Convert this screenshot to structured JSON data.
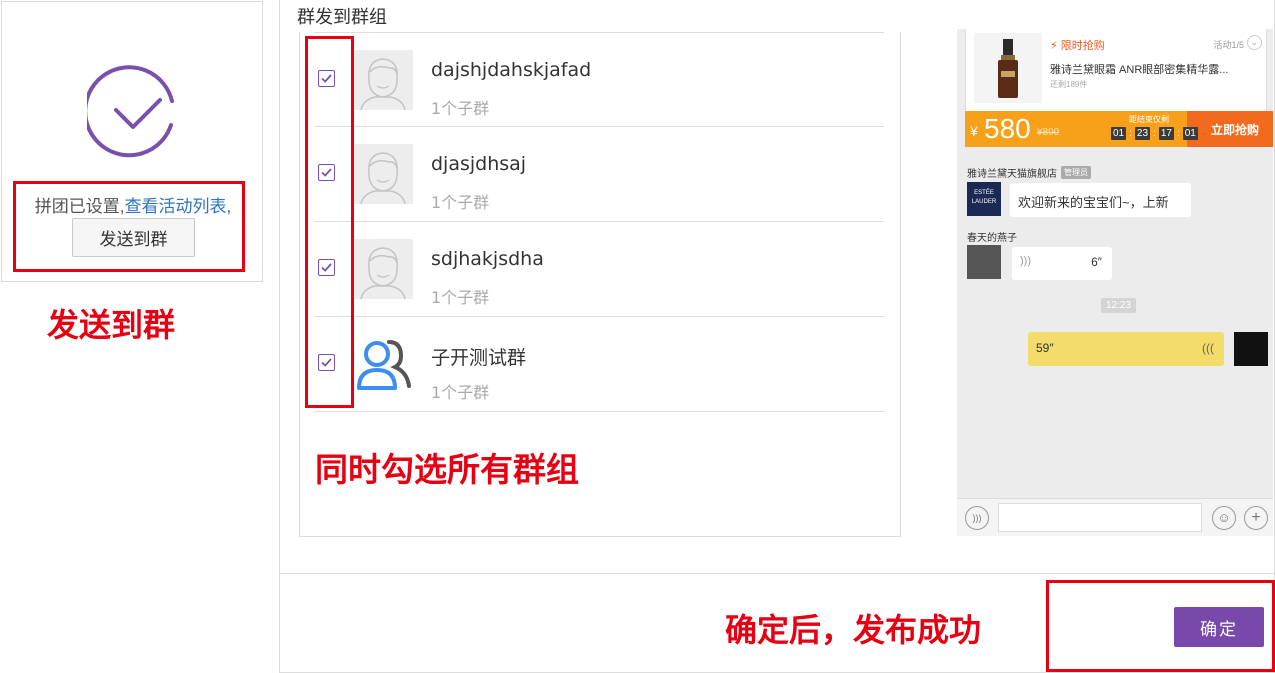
{
  "success_card": {
    "status_text": "拼团已设置,",
    "link_text": "查看活动列表",
    "trailing_comma": ",",
    "send_button": "发送到群",
    "icon": "check-circle-icon",
    "accent_color": "#7a4fae"
  },
  "dialog": {
    "title": "群发到群组",
    "groups": [
      {
        "name": "dajshjdahskjafad",
        "sub": "1个子群",
        "checked": true,
        "avatar": "person-avatar-icon"
      },
      {
        "name": "djasjdhsaj",
        "sub": "1个子群",
        "checked": true,
        "avatar": "person-avatar-icon"
      },
      {
        "name": "sdjhakjsdha",
        "sub": "1个子群",
        "checked": true,
        "avatar": "person-avatar-icon"
      },
      {
        "name": "子开测试群",
        "sub": "1个子群",
        "checked": true,
        "avatar": "group-icon"
      }
    ],
    "confirm_button": "确定",
    "confirm_color": "#7849ab"
  },
  "annotations": {
    "send_to_group": "发送到群",
    "select_all_groups": "同时勾选所有群组",
    "confirm_success": "确定后，发布成功",
    "color": "#e60012"
  },
  "preview": {
    "product": {
      "flash_sale": "限时抢购",
      "activity_count": "活动1/5",
      "title": "雅诗兰黛眼霜 ANR眼部密集精华露...",
      "stock": "还剩189件"
    },
    "price": {
      "yen": "¥",
      "now": "580",
      "old": "¥800",
      "countdown_label": "距结束仅剩",
      "countdown": [
        "01",
        "23",
        "17",
        "01"
      ],
      "buy_button": "立即抢购"
    },
    "chat": {
      "shop_name": "雅诗兰黛天猫旗舰店",
      "admin_badge": "管理员",
      "shop_logo_text": "ESTĒE LAUDER",
      "welcome": "欢迎新来的宝宝们~，上新",
      "user_name": "春天的燕子",
      "voice_in_length": "6″",
      "time": "12:23",
      "voice_out_length": "59″"
    }
  }
}
